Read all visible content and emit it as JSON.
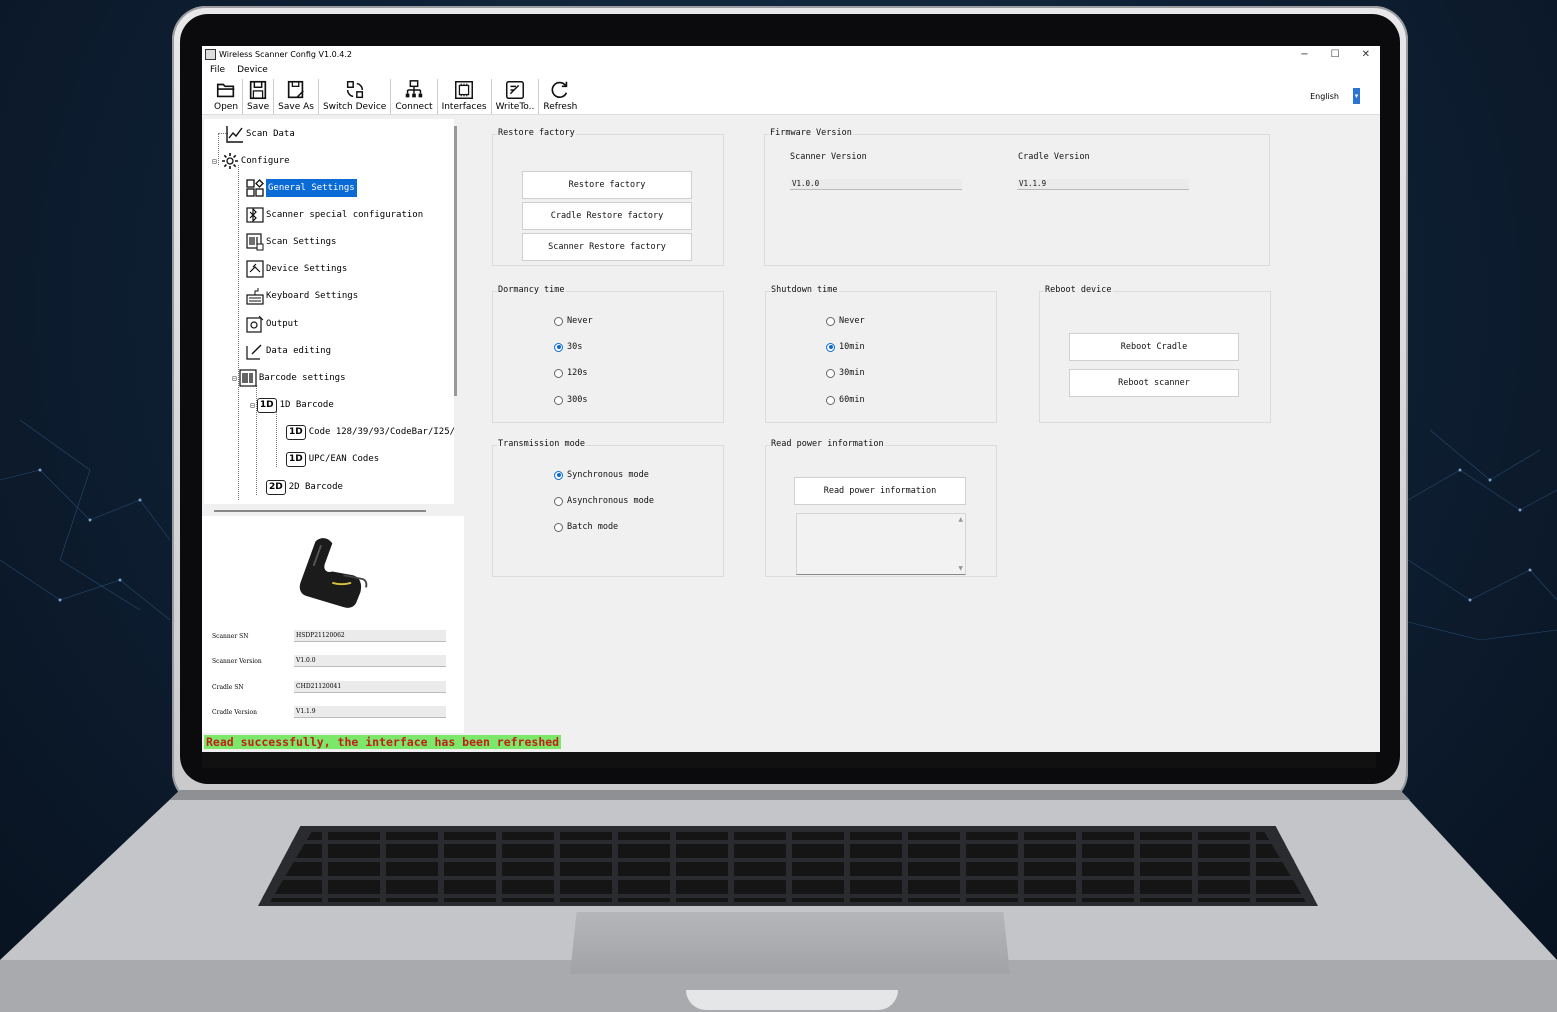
{
  "window": {
    "title": "Wireless Scanner Config V1.0.4.2",
    "minimize": "−",
    "maximize": "☐",
    "close": "✕"
  },
  "menu": {
    "file": "File",
    "device": "Device"
  },
  "toolbar": {
    "open": "Open",
    "save": "Save",
    "save_as": "Save As",
    "switch_device": "Switch Device",
    "connect": "Connect",
    "interfaces": "Interfaces",
    "write_to": "WriteTo..",
    "refresh": "Refresh",
    "language": "English"
  },
  "tree": {
    "scan_data": "Scan Data",
    "configure": "Configure",
    "general_settings": "General Settings",
    "scanner_special": "Scanner special configuration",
    "scan_settings": "Scan Settings",
    "device_settings": "Device Settings",
    "keyboard_settings": "Keyboard Settings",
    "output": "Output",
    "data_editing": "Data editing",
    "barcode_settings": "Barcode settings",
    "barcode_1d": "1D Barcode",
    "code128": "Code 128/39/93/CodeBar/I25/GS",
    "upc_ean": "UPC/EAN Codes",
    "barcode_2d": "2D Barcode",
    "badge_1d": "1D",
    "badge_2d": "2D"
  },
  "device_info": {
    "scanner_sn_label": "Scanner SN",
    "scanner_sn": "HSDP21120062",
    "scanner_version_label": "Scanner Version",
    "scanner_version": "V1.0.0",
    "cradle_sn_label": "Cradle SN",
    "cradle_sn": "CHD21120041",
    "cradle_version_label": "Cradle Version",
    "cradle_version": "V1.1.9"
  },
  "restore": {
    "title": "Restore factory",
    "restore_btn": "Restore factory",
    "cradle_btn": "Cradle Restore factory",
    "scanner_btn": "Scanner Restore factory"
  },
  "firmware": {
    "title": "Firmware Version",
    "scanner_label": "Scanner Version",
    "scanner_value": "V1.0.0",
    "cradle_label": "Cradle Version",
    "cradle_value": "V1.1.9"
  },
  "dormancy": {
    "title": "Dormancy time",
    "options": [
      "Never",
      "30s",
      "120s",
      "300s"
    ],
    "selected": "30s"
  },
  "shutdown": {
    "title": "Shutdown time",
    "options": [
      "Never",
      "10min",
      "30min",
      "60min"
    ],
    "selected": "10min"
  },
  "reboot": {
    "title": "Reboot device",
    "cradle_btn": "Reboot Cradle",
    "scanner_btn": "Reboot scanner"
  },
  "transmission": {
    "title": "Transmission mode",
    "options": [
      "Synchronous mode",
      "Asynchronous mode",
      "Batch mode"
    ],
    "selected": "Synchronous mode"
  },
  "power": {
    "title": "Read power information",
    "btn": "Read power information"
  },
  "status": {
    "message": "Read successfully, the interface has been refreshed"
  },
  "colors": {
    "selection": "#0a6ad6",
    "status_bg": "#7ce86a",
    "status_text": "#c0201a"
  }
}
